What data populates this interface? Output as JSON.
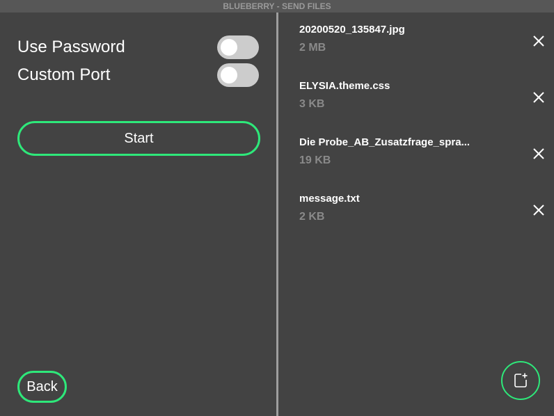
{
  "window": {
    "title": "BLUEBERRY - SEND FILES"
  },
  "options": [
    {
      "label": "Use Password",
      "enabled": false
    },
    {
      "label": "Custom Port",
      "enabled": false
    }
  ],
  "actions": {
    "start_label": "Start",
    "back_label": "Back"
  },
  "files": [
    {
      "name": "20200520_135847.jpg",
      "size": "2 MB"
    },
    {
      "name": "ELYSIA.theme.css",
      "size": "3 KB"
    },
    {
      "name": "Die Probe_AB_Zusatzfrage_spra...",
      "size": "19 KB"
    },
    {
      "name": "message.txt",
      "size": "2 KB"
    }
  ],
  "icons": {
    "remove": "close-icon",
    "add": "add-file-icon"
  },
  "colors": {
    "accent": "#2ee87a",
    "background": "#434343",
    "toggle_off": "#cccccc"
  }
}
